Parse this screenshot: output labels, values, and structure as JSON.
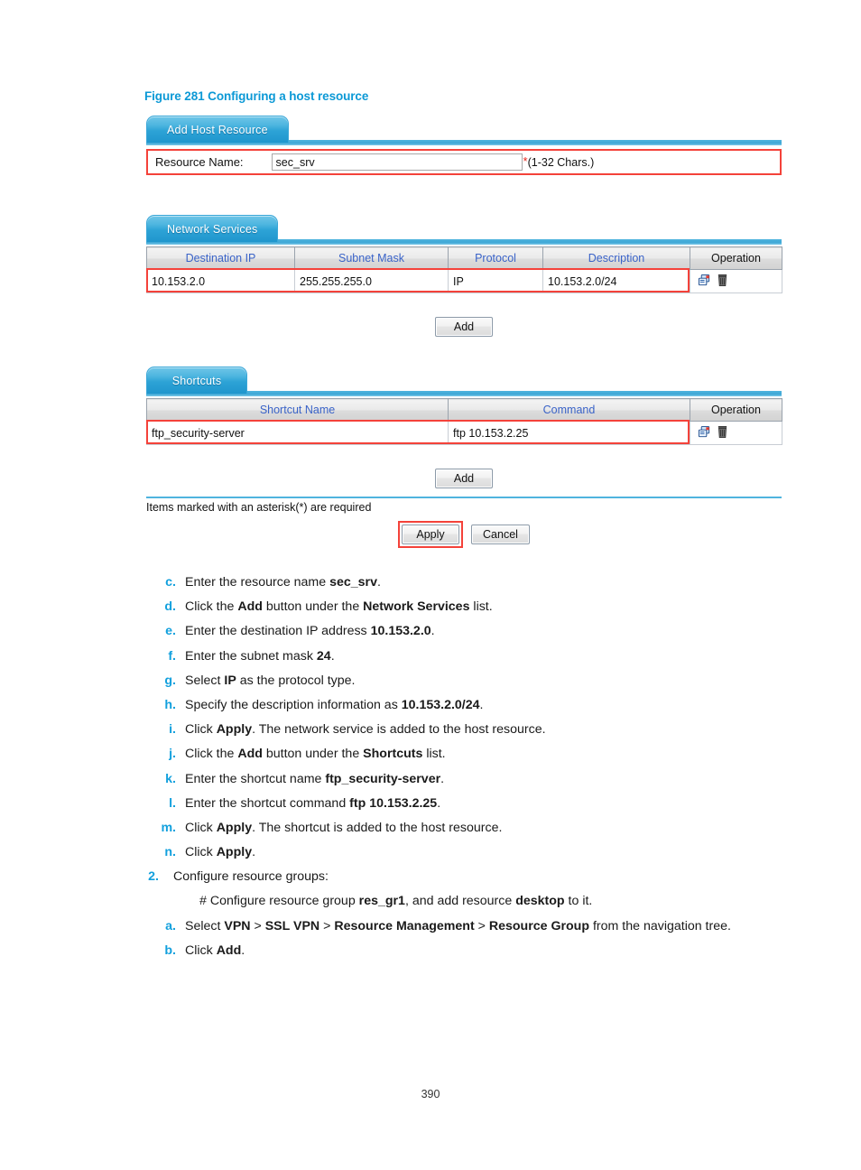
{
  "figure": {
    "caption": "Figure 281 Configuring a host resource",
    "caption_color": "#0c99d6"
  },
  "host_resource_panel": {
    "tab_label": "Add Host Resource",
    "resource_name": {
      "label": "Resource Name:",
      "value": "sec_srv",
      "placeholder": "",
      "required_marker": "*",
      "hint": "(1-32 Chars.)"
    }
  },
  "network_services": {
    "tab_label": "Network Services",
    "columns": [
      "Destination IP",
      "Subnet Mask",
      "Protocol",
      "Description",
      "Operation"
    ],
    "rows": [
      {
        "destination_ip": "10.153.2.0",
        "subnet_mask": "255.255.255.0",
        "protocol": "IP",
        "description": "10.153.2.0/24",
        "operation_icons": [
          "edit-icon",
          "delete-icon"
        ]
      }
    ],
    "add_label": "Add"
  },
  "shortcuts": {
    "tab_label": "Shortcuts",
    "columns": [
      "Shortcut Name",
      "Command",
      "Operation"
    ],
    "rows": [
      {
        "shortcut_name": "ftp_security-server",
        "command": "ftp 10.153.2.25",
        "operation_icons": [
          "edit-icon",
          "delete-icon"
        ]
      }
    ],
    "add_label": "Add"
  },
  "footer": {
    "asterisk_note": "Items marked with an asterisk(*) are required",
    "apply_label": "Apply",
    "cancel_label": "Cancel"
  },
  "steps": {
    "c": {
      "marker": "c.",
      "parts": [
        {
          "t": "Enter the resource name "
        },
        {
          "t": "sec_srv",
          "b": true
        },
        {
          "t": "."
        }
      ]
    },
    "d": {
      "marker": "d.",
      "parts": [
        {
          "t": "Click the "
        },
        {
          "t": "Add",
          "b": true
        },
        {
          "t": " button under the "
        },
        {
          "t": "Network Services",
          "b": true
        },
        {
          "t": " list."
        }
      ]
    },
    "e": {
      "marker": "e.",
      "parts": [
        {
          "t": "Enter the destination IP address "
        },
        {
          "t": "10.153.2.0",
          "b": true
        },
        {
          "t": "."
        }
      ]
    },
    "f": {
      "marker": "f.",
      "parts": [
        {
          "t": "Enter the subnet mask "
        },
        {
          "t": "24",
          "b": true
        },
        {
          "t": "."
        }
      ]
    },
    "g": {
      "marker": "g.",
      "parts": [
        {
          "t": "Select "
        },
        {
          "t": "IP",
          "b": true
        },
        {
          "t": " as the protocol type."
        }
      ]
    },
    "h": {
      "marker": "h.",
      "parts": [
        {
          "t": "Specify the description information as "
        },
        {
          "t": "10.153.2.0/24",
          "b": true
        },
        {
          "t": "."
        }
      ]
    },
    "i": {
      "marker": "i.",
      "parts": [
        {
          "t": "Click "
        },
        {
          "t": "Apply",
          "b": true
        },
        {
          "t": ". The network service is added to the host resource."
        }
      ]
    },
    "j": {
      "marker": "j.",
      "parts": [
        {
          "t": "Click the "
        },
        {
          "t": "Add",
          "b": true
        },
        {
          "t": " button under the "
        },
        {
          "t": "Shortcuts",
          "b": true
        },
        {
          "t": " list."
        }
      ]
    },
    "k": {
      "marker": "k.",
      "parts": [
        {
          "t": "Enter the shortcut name "
        },
        {
          "t": "ftp_security-server",
          "b": true
        },
        {
          "t": "."
        }
      ]
    },
    "l": {
      "marker": "l.",
      "parts": [
        {
          "t": "Enter the shortcut command "
        },
        {
          "t": "ftp 10.153.2.25",
          "b": true
        },
        {
          "t": "."
        }
      ]
    },
    "m": {
      "marker": "m.",
      "parts": [
        {
          "t": "Click "
        },
        {
          "t": "Apply",
          "b": true
        },
        {
          "t": ". The shortcut is added to the host resource."
        }
      ]
    },
    "n": {
      "marker": "n.",
      "parts": [
        {
          "t": "Click "
        },
        {
          "t": "Apply",
          "b": true
        },
        {
          "t": "."
        }
      ]
    },
    "two": {
      "marker": "2.",
      "parts": [
        {
          "t": "Configure resource groups:"
        }
      ]
    },
    "two_note": {
      "parts": [
        {
          "t": "# Configure resource group "
        },
        {
          "t": "res_gr1",
          "b": true
        },
        {
          "t": ", and add resource "
        },
        {
          "t": "desktop",
          "b": true
        },
        {
          "t": " to it."
        }
      ]
    },
    "two_a": {
      "marker": "a.",
      "parts": [
        {
          "t": "Select "
        },
        {
          "t": "VPN",
          "b": true
        },
        {
          "t": " > "
        },
        {
          "t": "SSL VPN",
          "b": true
        },
        {
          "t": " > "
        },
        {
          "t": "Resource Management",
          "b": true
        },
        {
          "t": " > "
        },
        {
          "t": "Resource Group",
          "b": true
        },
        {
          "t": " from the navigation tree."
        }
      ]
    },
    "two_b": {
      "marker": "b.",
      "parts": [
        {
          "t": "Click "
        },
        {
          "t": "Add",
          "b": true
        },
        {
          "t": "."
        }
      ]
    }
  },
  "page_number": "390"
}
